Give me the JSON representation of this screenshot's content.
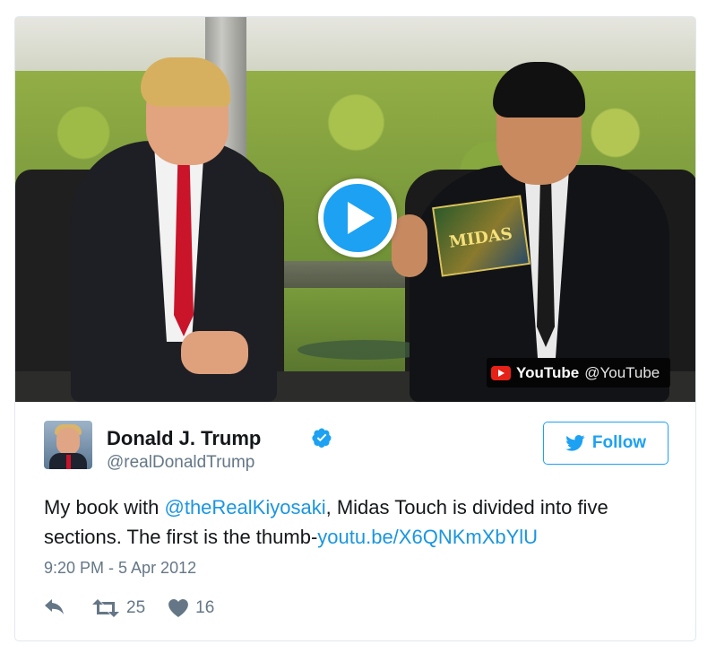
{
  "video": {
    "book_title": "MIDAS",
    "yt_brand": "YouTube",
    "yt_handle": "@YouTube",
    "icons": {
      "play": "play-icon",
      "youtube": "youtube-logo-icon"
    },
    "play_color": "#1da1f2"
  },
  "tweet": {
    "author_name": "Donald J. Trump",
    "author_handle": "@realDonaldTrump",
    "verified_icon": "verified-badge-icon",
    "follow_label": "Follow",
    "text_part1": "My book with ",
    "mention": "@theRealKiyosaki",
    "text_part2": ", Midas Touch is divided into five sections. The first is the thumb-",
    "link": "youtu.be/X6QNKmXbYlU",
    "timestamp": "9:20 PM - 5 Apr 2012",
    "retweet_count": "25",
    "like_count": "16"
  },
  "colors": {
    "accent": "#1da1f2",
    "link": "#1b95e0",
    "muted": "#657786",
    "text": "#14171a",
    "youtube_red": "#e62117"
  }
}
